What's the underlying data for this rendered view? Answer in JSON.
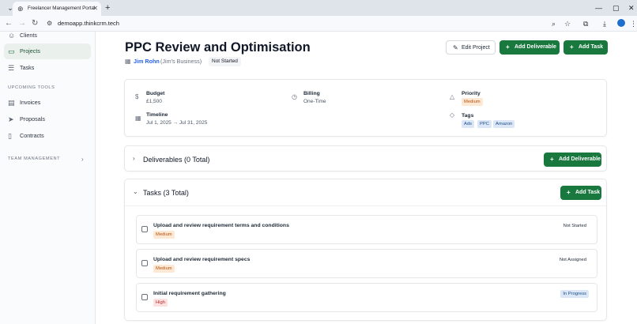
{
  "browser": {
    "tab_title": "Freelancer Management Portal",
    "url": "demoapp.thinkcrm.tech",
    "icons": {
      "tab_menu": "chevron-down-icon",
      "favicon": "globe-icon",
      "tab_close": "close-icon",
      "new_tab": "plus-icon",
      "minimize": "minimize-icon",
      "maximize": "maximize-icon",
      "close": "close-icon",
      "back": "back-arrow-icon",
      "forward": "forward-arrow-icon",
      "reload": "reload-icon",
      "site_info": "site-info-icon",
      "zoom": "zoom-icon",
      "bookmark": "star-icon",
      "extensions": "puzzle-icon",
      "download": "download-icon",
      "profile": "avatar-icon"
    },
    "glyphs": {
      "tab_menu": "⌄",
      "favicon": "⊕",
      "tab_close": "✕",
      "new_tab": "+",
      "minimize": "—",
      "maximize": "▢",
      "close": "✕",
      "back": "←",
      "forward": "→",
      "reload": "↻",
      "site_info": "⚙",
      "zoom": "⌕",
      "bookmark": "☆",
      "extensions": "⧉",
      "download": "⤓",
      "menu": "⋮"
    }
  },
  "sidebar": {
    "items": [
      {
        "label": "Clients",
        "icon": "users-icon",
        "glyph": "☺"
      },
      {
        "label": "Projects",
        "icon": "folder-icon",
        "glyph": "▭"
      },
      {
        "label": "Tasks",
        "icon": "clipboard-icon",
        "glyph": "☰"
      },
      {
        "label": "Invoices",
        "icon": "invoice-icon",
        "glyph": "▤"
      },
      {
        "label": "Proposals",
        "icon": "send-icon",
        "glyph": "➤"
      },
      {
        "label": "Contracts",
        "icon": "document-icon",
        "glyph": "▯"
      }
    ],
    "active_item": "Projects",
    "sections": {
      "upcoming_tools": "UPCOMING TOOLS",
      "team_management": "TEAM MANAGEMENT"
    },
    "chevron_glyph": "›"
  },
  "header": {
    "title": "PPC Review and Optimisation",
    "client_name": "Jim Rohn",
    "client_business": "(Jim's Business)",
    "client_icon_glyph": "▦",
    "status": "Not Started",
    "buttons": {
      "edit_project": "Edit Project",
      "add_deliverable": "Add Deliverable",
      "add_task": "Add Task"
    },
    "glyphs": {
      "edit": "✎",
      "plus": "+"
    }
  },
  "details": {
    "budget": {
      "label": "Budget",
      "value": "£1,500",
      "glyph": "$"
    },
    "timeline": {
      "label": "Timeline",
      "value": "Jul 1, 2025 → Jul 31, 2025",
      "glyph": "▦"
    },
    "billing": {
      "label": "Billing",
      "value": "One-Time",
      "glyph": "◷"
    },
    "priority": {
      "label": "Priority",
      "value": "Medium",
      "glyph": "△"
    },
    "tags": {
      "label": "Tags",
      "values": [
        "Ads",
        "PPC",
        "Amazon"
      ],
      "glyph": "◇"
    }
  },
  "deliverables": {
    "title": "Deliverables (0 Total)",
    "button": "Add Deliverable",
    "chevron_glyph": "›"
  },
  "tasks": {
    "title": "Tasks (3 Total)",
    "button": "Add Task",
    "chevron_glyph": "⌄",
    "items": [
      {
        "title": "Upload and review requirement terms and conditions",
        "priority": "Medium",
        "status": "Not Started"
      },
      {
        "title": "Upload and review requirement specs",
        "priority": "Medium",
        "status": "Not Assigned"
      },
      {
        "title": "Initial requirement gathering",
        "priority": "High",
        "status": "In Progress"
      }
    ]
  },
  "colors": {
    "primary_green": "#18783e",
    "link_blue": "#2563eb",
    "medium_badge": "#fde8d4",
    "high_badge": "#fde0e0",
    "tag_badge": "#dbe7f7"
  }
}
